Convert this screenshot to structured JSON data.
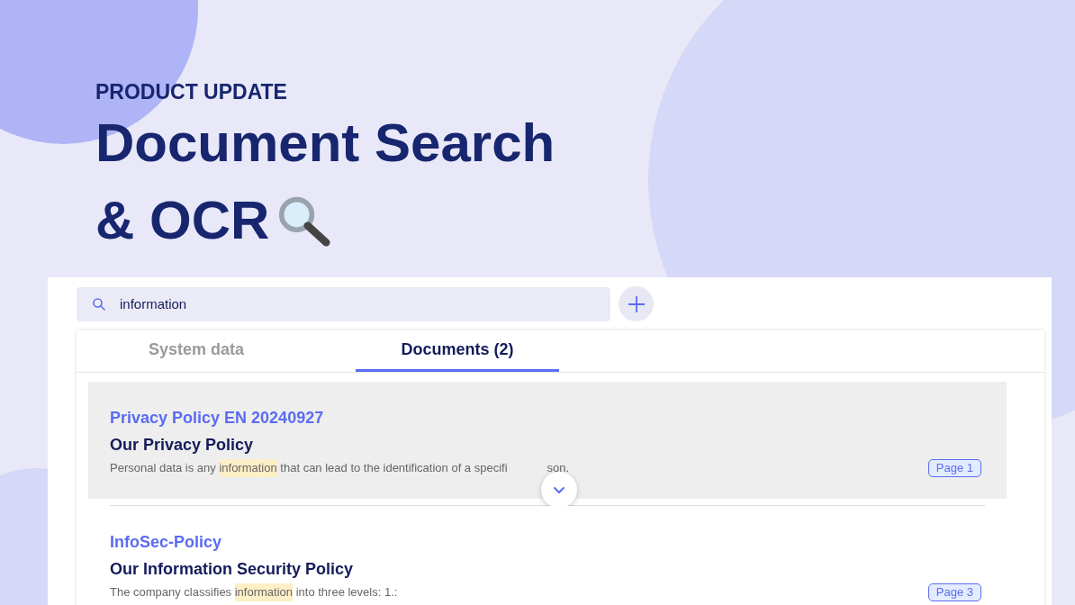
{
  "header": {
    "eyebrow": "PRODUCT UPDATE",
    "title_lines": [
      "Document Search",
      "& OCR"
    ]
  },
  "search": {
    "value": "information"
  },
  "tabs": [
    {
      "label": "System data",
      "selected": false
    },
    {
      "label": "Documents (2)",
      "selected": true
    }
  ],
  "results": [
    {
      "source": "Privacy Policy EN 20240927",
      "title": "Our Privacy Policy",
      "selected": true,
      "segments": [
        {
          "text": "Personal data is any ",
          "highlight": false
        },
        {
          "text": "information",
          "highlight": true
        },
        {
          "text": " that can lead to the identification of a specifi",
          "highlight": false
        }
      ],
      "continuation": "son.",
      "page": "Page 1"
    },
    {
      "source": "InfoSec-Policy",
      "title": "Our Information Security Policy",
      "selected": false,
      "segments": [
        {
          "text": "The company classifies ",
          "highlight": false
        },
        {
          "text": "information",
          "highlight": true
        },
        {
          "text": " into three levels: 1.:",
          "highlight": false
        }
      ],
      "page": "Page 3"
    }
  ]
}
